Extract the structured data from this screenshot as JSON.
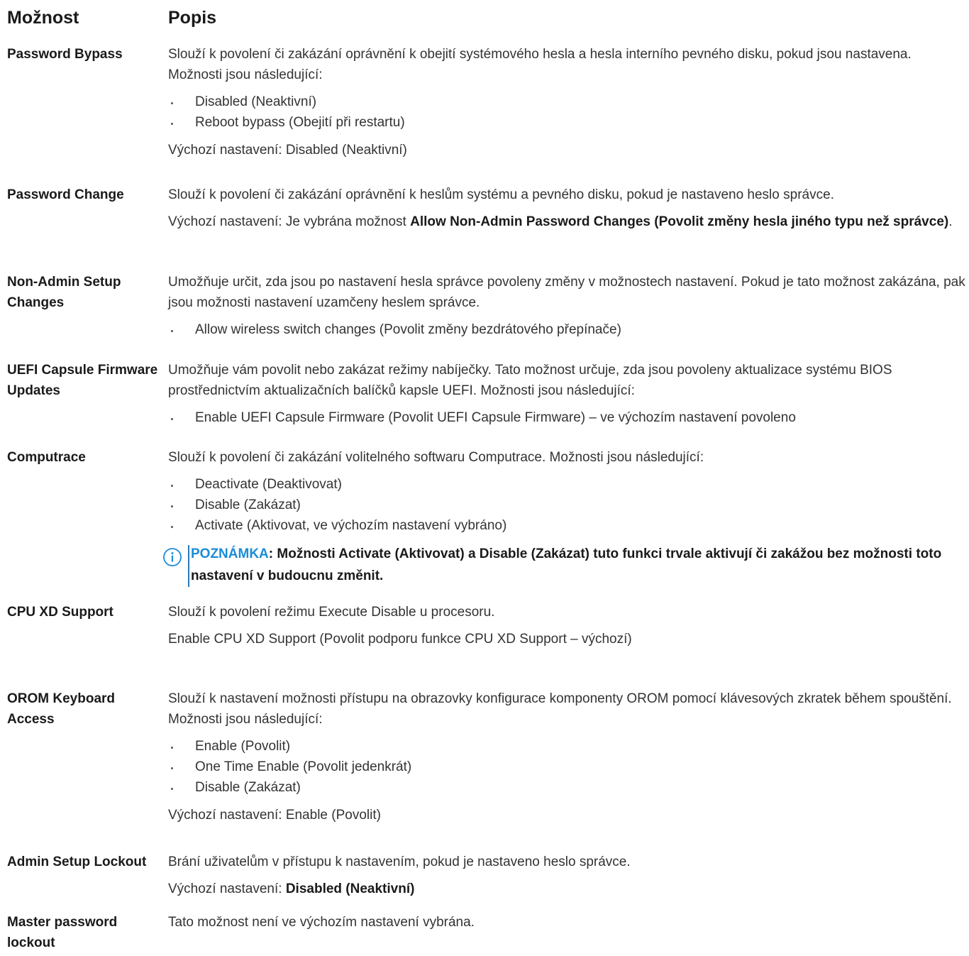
{
  "header": {
    "col_option": "Možnost",
    "col_desc": "Popis"
  },
  "rows": [
    {
      "option": "Password Bypass",
      "text1": "Slouží k povolení či zakázání oprávnění k obejití systémového hesla a hesla interního pevného disku, pokud jsou nastavena. Možnosti jsou následující:",
      "bullets": [
        "Disabled (Neaktivní)",
        "Reboot bypass (Obejití při restartu)"
      ],
      "text2": "Výchozí nastavení: Disabled (Neaktivní)"
    },
    {
      "option": "Password Change",
      "text1": "Slouží k povolení či zakázání oprávnění k heslům systému a pevného disku, pokud je nastaveno heslo správce.",
      "text2_prefix": "Výchozí nastavení: Je vybrána možnost ",
      "text2_bold": "Allow Non-Admin Password Changes (Povolit změny hesla jiného typu než správce)",
      "text2_suffix": "."
    },
    {
      "option": "Non-Admin Setup Changes",
      "text1": "Umožňuje určit, zda jsou po nastavení hesla správce povoleny změny v možnostech nastavení. Pokud je tato možnost zakázána, pak jsou možnosti nastavení uzamčeny heslem správce.",
      "bullets": [
        "Allow wireless switch changes (Povolit změny bezdrátového přepínače)"
      ]
    },
    {
      "option": "UEFI Capsule Firmware Updates",
      "text1": "Umožňuje vám povolit nebo zakázat režimy nabíječky. Tato možnost určuje, zda jsou povoleny aktualizace systému BIOS prostřednictvím aktualizačních balíčků kapsle UEFI. Možnosti jsou následující:",
      "bullets": [
        "Enable UEFI Capsule Firmware (Povolit UEFI Capsule Firmware) – ve výchozím nastavení povoleno"
      ]
    },
    {
      "option": "Computrace",
      "text1": "Slouží k povolení či zakázání volitelného softwaru Computrace. Možnosti jsou následující:",
      "bullets": [
        "Deactivate (Deaktivovat)",
        "Disable (Zakázat)",
        "Activate (Aktivovat, ve výchozím nastavení vybráno)"
      ],
      "note_label": "POZNÁMKA",
      "note_text": ": Možnosti Activate (Aktivovat) a Disable (Zakázat) tuto funkci trvale aktivují či zakážou bez možnosti toto nastavení v budoucnu změnit."
    },
    {
      "option": "CPU XD Support",
      "text1": "Slouží k povolení režimu Execute Disable u procesoru.",
      "text2": "Enable CPU XD Support (Povolit podporu funkce CPU XD Support – výchozí)"
    },
    {
      "option": "OROM Keyboard Access",
      "text1": "Slouží k nastavení možnosti přístupu na obrazovky konfigurace komponenty OROM pomocí klávesových zkratek během spouštění. Možnosti jsou následující:",
      "bullets": [
        "Enable (Povolit)",
        "One Time Enable (Povolit jedenkrát)",
        "Disable (Zakázat)"
      ],
      "text2": "Výchozí nastavení: Enable (Povolit)"
    },
    {
      "option": "Admin Setup Lockout",
      "text1": "Brání uživatelům v přístupu k nastavením, pokud je nastaveno heslo správce.",
      "text2_prefix": "Výchozí nastavení: ",
      "text2_bold": "Disabled (Neaktivní)"
    },
    {
      "option": "Master password lockout",
      "text1": "Tato možnost není ve výchozím nastavení vybrána."
    }
  ],
  "icons": {
    "note": "info-icon"
  },
  "colors": {
    "note_label": "#1a8cd8",
    "note_bar": "#2a7ab8",
    "text": "#333333"
  }
}
